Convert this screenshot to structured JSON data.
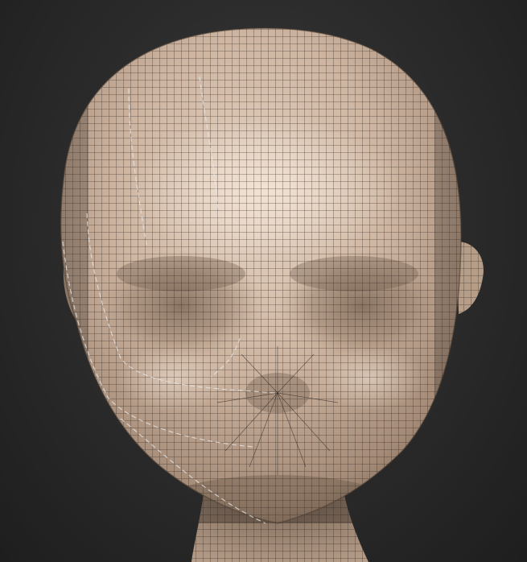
{
  "scene": {
    "subject": "head-sculpt",
    "colors": {
      "background_center": "#3a3a3a",
      "background_edge": "#1e1e1e",
      "skin_light": "#e2cdbc",
      "skin_mid": "#b9a18c",
      "skin_dark": "#6e5c4e",
      "wireframe": "#2a2019",
      "seam": "#e8e8e8"
    },
    "icons": [
      "wireframe-grid",
      "uv-seam"
    ]
  }
}
